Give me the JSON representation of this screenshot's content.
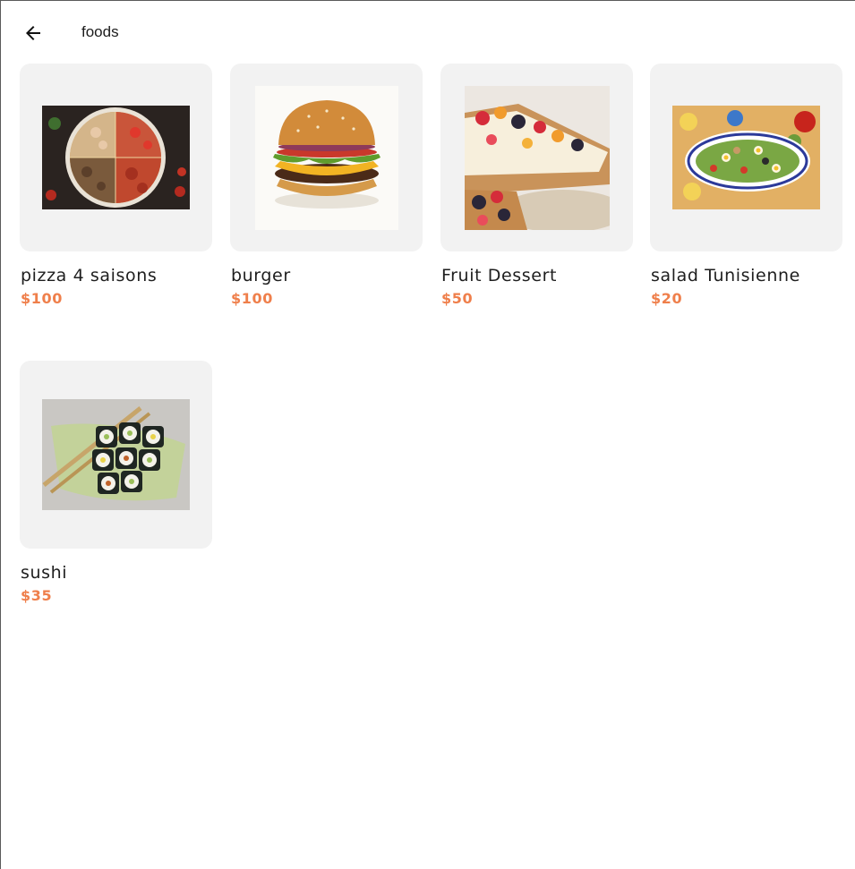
{
  "header": {
    "back_icon": "arrow-left-icon",
    "title": "foods"
  },
  "colors": {
    "price": "#ef7f4b",
    "card_bg": "#f2f2f2",
    "text": "#1e1e1e"
  },
  "foods": [
    {
      "name": "pizza 4 saisons",
      "price": "$100",
      "image": "pizza-image"
    },
    {
      "name": "burger",
      "price": "$100",
      "image": "burger-image"
    },
    {
      "name": "Fruit Dessert",
      "price": "$50",
      "image": "fruit-tart-image"
    },
    {
      "name": "salad Tunisienne",
      "price": "$20",
      "image": "salad-image"
    },
    {
      "name": "sushi",
      "price": "$35",
      "image": "sushi-image"
    }
  ]
}
